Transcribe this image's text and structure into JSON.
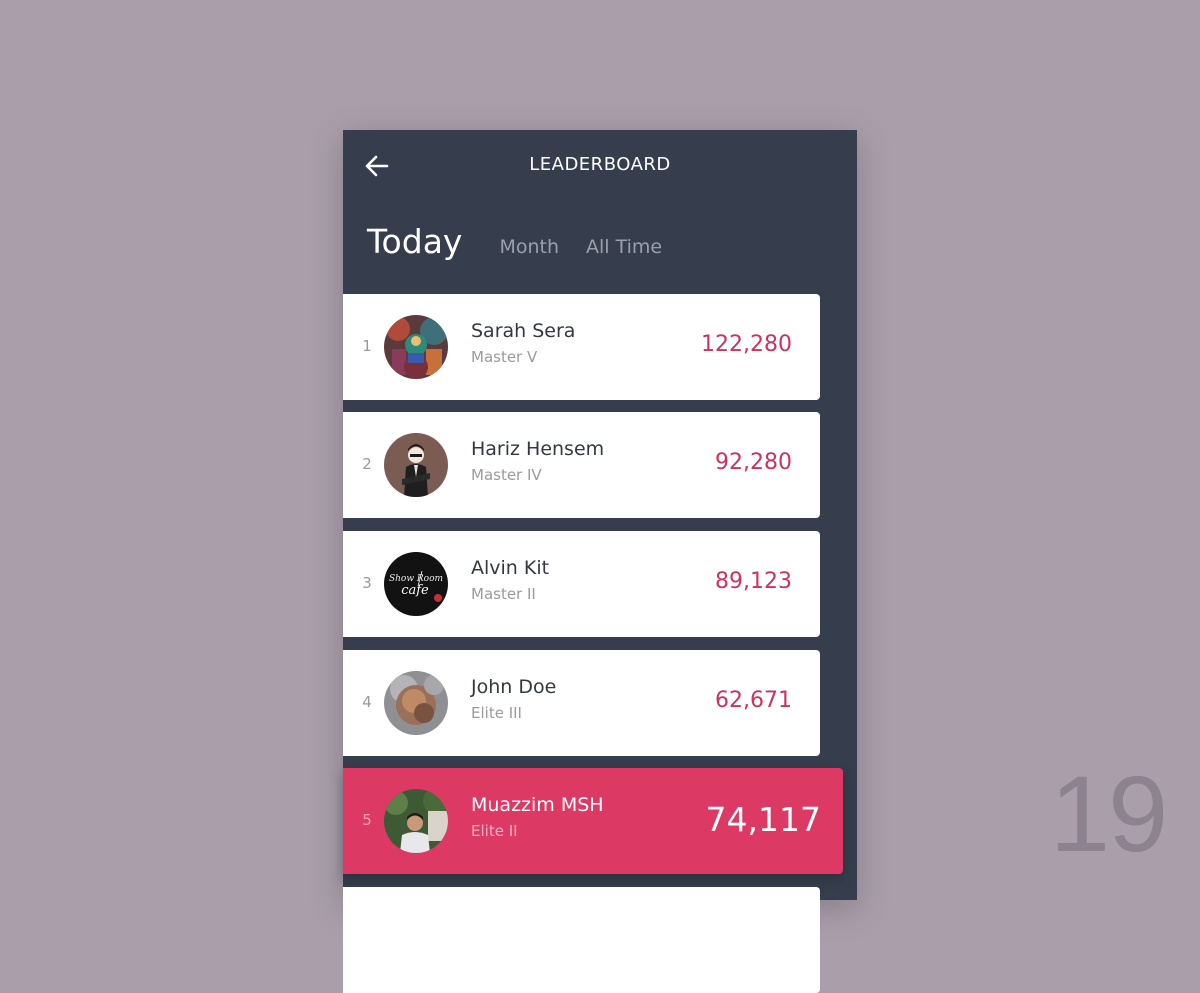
{
  "header": {
    "title": "LEADERBOARD",
    "back_icon": "arrow-left-icon"
  },
  "tabs": [
    {
      "label": "Today",
      "active": true
    },
    {
      "label": "Month",
      "active": false
    },
    {
      "label": "All Time",
      "active": false
    }
  ],
  "leaderboard": [
    {
      "rank": "1",
      "name": "Sarah Sera",
      "level": "Master V",
      "score": "122,280",
      "highlight": false
    },
    {
      "rank": "2",
      "name": "Hariz Hensem",
      "level": "Master IV",
      "score": "92,280",
      "highlight": false
    },
    {
      "rank": "3",
      "name": "Alvin Kit",
      "level": "Master II",
      "score": "89,123",
      "highlight": false
    },
    {
      "rank": "4",
      "name": "John Doe",
      "level": "Elite III",
      "score": "62,671",
      "highlight": false
    },
    {
      "rank": "5",
      "name": "Muazzim MSH",
      "level": "Elite II",
      "score": "74,117",
      "highlight": true
    }
  ],
  "avatar_logo_text": "Show Room cafe",
  "page_number": "19",
  "colors": {
    "background": "#a99ea9",
    "panel": "#363e4d",
    "accent": "#dc3a64",
    "score": "#c9335d"
  }
}
